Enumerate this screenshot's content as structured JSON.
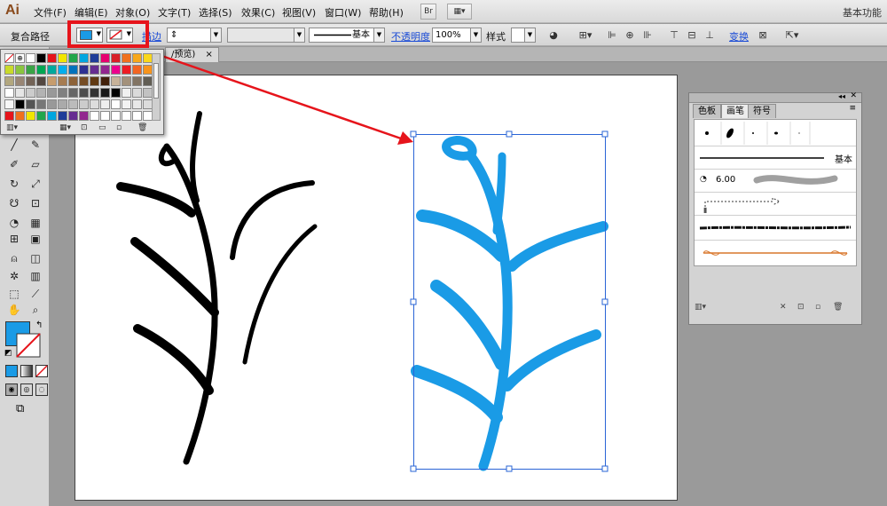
{
  "app": {
    "logo": "Ai",
    "workspace": "基本功能"
  },
  "menu": [
    "文件(F)",
    "编辑(E)",
    "对象(O)",
    "文字(T)",
    "选择(S)",
    "效果(C)",
    "视图(V)",
    "窗口(W)",
    "帮助(H)"
  ],
  "menu_buttons": {
    "bridge": "Br",
    "arrange": "▦▾"
  },
  "control_bar": {
    "selection_type": "复合路径",
    "stroke_label": "描边",
    "brush_name": "基本",
    "opacity_label": "不透明度",
    "opacity_value": "100%",
    "style_label": "样式",
    "transform_label": "变换"
  },
  "colors": {
    "fill": "#1a9be6",
    "stroke": "#ffffff",
    "artwork_blue": "#1a9be6",
    "highlight_red": "#e6141b"
  },
  "document_tab": {
    "label": "/预览)"
  },
  "brushes_panel": {
    "tabs": [
      "色板",
      "画笔",
      "符号"
    ],
    "active_tab": "画笔",
    "basic_label": "基本",
    "size_value": "6.00"
  },
  "toolbox": {
    "tools": [
      "selection-tool",
      "direct-selection-tool",
      "magic-wand-tool",
      "lasso-tool",
      "pen-tool",
      "type-tool",
      "line-tool",
      "rectangle-tool",
      "paintbrush-tool",
      "pencil-tool",
      "blob-brush-tool",
      "eraser-tool",
      "rotate-tool",
      "scale-tool",
      "warp-tool",
      "free-transform-tool",
      "shape-builder-tool",
      "perspective-grid-tool",
      "mesh-tool",
      "gradient-tool",
      "eyedropper-tool",
      "blend-tool",
      "symbol-sprayer-tool",
      "column-graph-tool",
      "artboard-tool",
      "slice-tool",
      "hand-tool",
      "zoom-tool"
    ]
  }
}
